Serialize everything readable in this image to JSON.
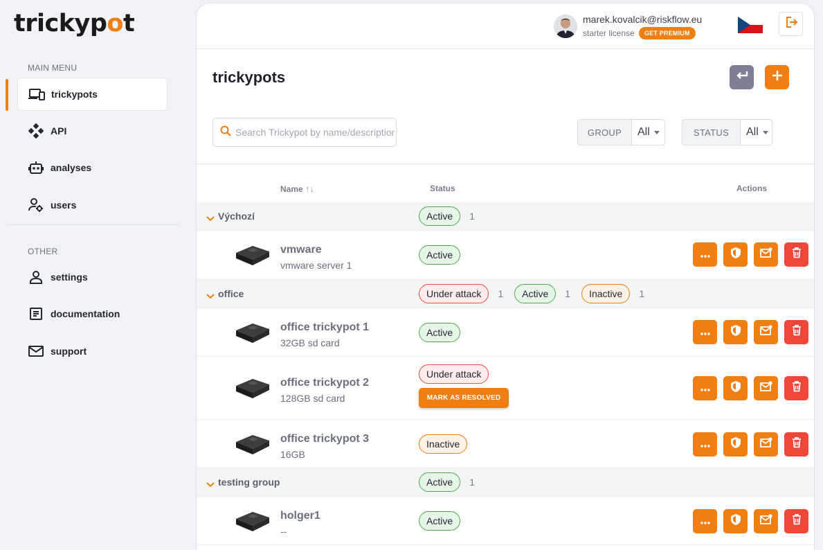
{
  "brand": {
    "logo_pre": "trickyp",
    "logo_o": "o",
    "logo_post": "t"
  },
  "sidebar": {
    "main_menu_label": "MAIN MENU",
    "other_label": "OTHER",
    "items": [
      {
        "label": "trickypots",
        "icon": "devices-icon"
      },
      {
        "label": "API",
        "icon": "api-icon"
      },
      {
        "label": "analyses",
        "icon": "robot-icon"
      },
      {
        "label": "users",
        "icon": "users-gear-icon"
      },
      {
        "label": "settings",
        "icon": "person-icon"
      },
      {
        "label": "documentation",
        "icon": "document-icon"
      },
      {
        "label": "support",
        "icon": "mail-icon"
      }
    ]
  },
  "header": {
    "email": "marek.kovalcik@riskflow.eu",
    "license": "starter license",
    "premium_label": "GET PREMIUM",
    "flag": "czech-flag-icon"
  },
  "page": {
    "title": "trickypots"
  },
  "search": {
    "placeholder": "Search Trickypot by name/description"
  },
  "filters": {
    "group_label": "GROUP",
    "group_value": "All",
    "status_label": "STATUS",
    "status_value": "All"
  },
  "table": {
    "col_name": "Name",
    "col_sort": "↑↓",
    "col_status": "Status",
    "col_actions": "Actions",
    "resolve_label": "MARK AS RESOLVED",
    "groups": [
      {
        "name": "Výchozí",
        "badges": [
          {
            "label": "Active",
            "count": "1"
          }
        ]
      },
      {
        "name": "office",
        "badges": [
          {
            "label": "Under attack",
            "count": "1"
          },
          {
            "label": "Active",
            "count": "1"
          },
          {
            "label": "Inactive",
            "count": "1"
          }
        ]
      },
      {
        "name": "testing group",
        "badges": [
          {
            "label": "Active",
            "count": "1"
          }
        ]
      }
    ],
    "items": [
      {
        "name": "vmware",
        "desc": "vmware server 1",
        "status": "Active"
      },
      {
        "name": "office trickypot 1",
        "desc": "32GB sd card",
        "status": "Active"
      },
      {
        "name": "office trickypot 2",
        "desc": "128GB sd card",
        "status": "Under attack"
      },
      {
        "name": "office trickypot 3",
        "desc": "16GB",
        "status": "Inactive"
      },
      {
        "name": "holger1",
        "desc": "--",
        "status": "Active"
      }
    ]
  },
  "colors": {
    "accent": "#f07e10",
    "danger": "#f0463a",
    "active": "#4caf50"
  }
}
